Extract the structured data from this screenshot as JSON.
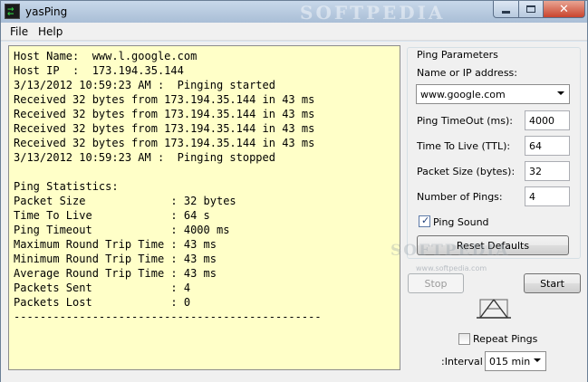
{
  "window": {
    "title": "yasPing",
    "watermark": "SOFTPEDIA",
    "close_glyph": "✕",
    "icon": "ping-arrows-icon"
  },
  "menu": {
    "file": "File",
    "help": "Help"
  },
  "output": {
    "lines": [
      "Host Name:  www.l.google.com",
      "Host IP  :  173.194.35.144",
      "3/13/2012 10:59:23 AM :  Pinging started",
      "Received 32 bytes from 173.194.35.144 in 43 ms",
      "Received 32 bytes from 173.194.35.144 in 43 ms",
      "Received 32 bytes from 173.194.35.144 in 43 ms",
      "Received 32 bytes from 173.194.35.144 in 43 ms",
      "3/13/2012 10:59:23 AM :  Pinging stopped",
      "",
      "Ping Statistics:",
      "Packet Size             : 32 bytes",
      "Time To Live            : 64 s",
      "Ping Timeout            : 4000 ms",
      "Maximum Round Trip Time : 43 ms",
      "Minimum Round Trip Time : 43 ms",
      "Average Round Trip Time : 43 ms",
      "Packets Sent            : 4",
      "Packets Lost            : 0",
      "-----------------------------------------------"
    ]
  },
  "params": {
    "group_label": "Ping Parameters",
    "name_label": "Name or IP address:",
    "name_value": "www.google.com",
    "timeout_label": "Ping TimeOut (ms):",
    "timeout_value": "4000",
    "ttl_label": "Time To Live (TTL):",
    "ttl_value": "64",
    "size_label": "Packet Size (bytes):",
    "size_value": "32",
    "count_label": "Number of Pings:",
    "count_value": "4",
    "sound_label": "Ping Sound",
    "sound_checked": true,
    "reset_label": "Reset Defaults"
  },
  "controls": {
    "stop_label": "Stop",
    "start_label": "Start",
    "repeat_label": "Repeat Pings",
    "repeat_checked": false,
    "interval_label": ":Interval",
    "interval_value": "015 min"
  },
  "watermarks": {
    "client_mark": "SOFTPEDIA",
    "url": "www.softpedia.com"
  },
  "colors": {
    "output_bg": "#ffffc8",
    "close_red": "#c9442d"
  }
}
